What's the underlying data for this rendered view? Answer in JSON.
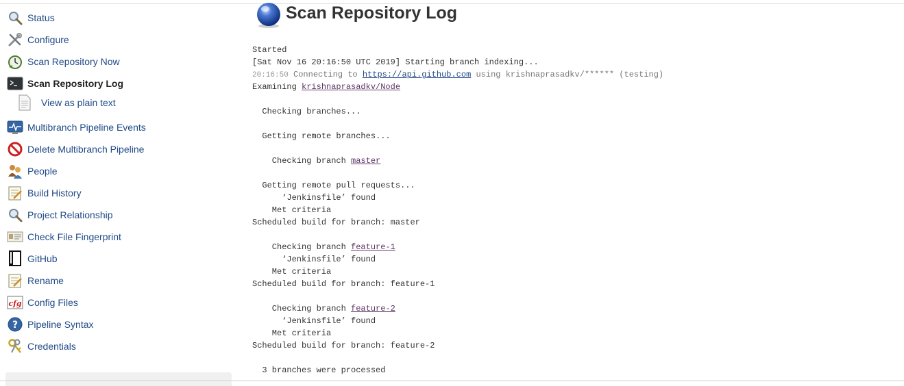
{
  "sidebar": {
    "items": [
      {
        "label": "Status",
        "icon": "magnifier-icon"
      },
      {
        "label": "Configure",
        "icon": "wrench-screwdriver-icon"
      },
      {
        "label": "Scan Repository Now",
        "icon": "clock-refresh-icon"
      },
      {
        "label": "Scan Repository Log",
        "icon": "terminal-icon"
      },
      {
        "label": "View as plain text",
        "icon": "document-icon"
      },
      {
        "label": "Multibranch Pipeline Events",
        "icon": "monitor-pulse-icon"
      },
      {
        "label": "Delete Multibranch Pipeline",
        "icon": "no-entry-icon"
      },
      {
        "label": "People",
        "icon": "people-icon"
      },
      {
        "label": "Build History",
        "icon": "notepad-icon"
      },
      {
        "label": "Project Relationship",
        "icon": "magnifier-icon"
      },
      {
        "label": "Check File Fingerprint",
        "icon": "id-card-icon"
      },
      {
        "label": "GitHub",
        "icon": "book-icon"
      },
      {
        "label": "Rename",
        "icon": "notepad-icon"
      },
      {
        "label": "Config Files",
        "icon": "cfg-icon"
      },
      {
        "label": "Pipeline Syntax",
        "icon": "help-icon"
      },
      {
        "label": "Credentials",
        "icon": "keys-icon"
      }
    ]
  },
  "page": {
    "title": "Scan Repository Log",
    "title_icon": "blue-ball-icon"
  },
  "log": {
    "l01": "Started",
    "l02": "[Sat Nov 16 20:16:50 UTC 2019] Starting branch indexing...",
    "l03_ts": "20:16:50",
    "l03_pre": " Connecting to ",
    "l03_link": "https://api.github.com",
    "l03_post": " using krishnaprasadkv/****** (testing)",
    "l04_pre": "Examining ",
    "l04_link": "krishnaprasadkv/Node",
    "l06": "  Checking branches...",
    "l08": "  Getting remote branches...",
    "l10_pre": "    Checking branch ",
    "l10_link": "master",
    "l12": "  Getting remote pull requests...",
    "l13": "      ‘Jenkinsfile’ found",
    "l14": "    Met criteria",
    "l15": "Scheduled build for branch: master",
    "l17_pre": "    Checking branch ",
    "l17_link": "feature-1",
    "l18": "      ‘Jenkinsfile’ found",
    "l19": "    Met criteria",
    "l20": "Scheduled build for branch: feature-1",
    "l22_pre": "    Checking branch ",
    "l22_link": "feature-2",
    "l23": "      ‘Jenkinsfile’ found",
    "l24": "    Met criteria",
    "l25": "Scheduled build for branch: feature-2",
    "l27": "  3 branches were processed"
  },
  "colors": {
    "link": "#204a87",
    "visited_link": "#5c3566",
    "text": "#333333"
  }
}
